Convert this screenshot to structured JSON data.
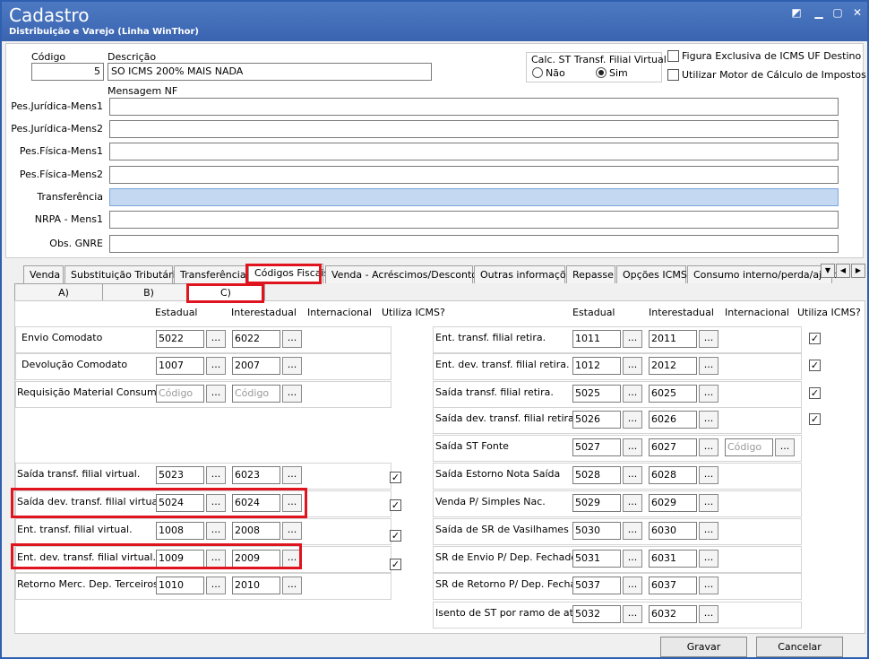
{
  "window": {
    "title": "Cadastro",
    "subtitle": "Distribuição e Varejo (Linha WinThor)"
  },
  "form": {
    "codigo_label": "Código",
    "codigo_value": "5",
    "descricao_label": "Descrição",
    "descricao_value": "SO ICMS 200% MAIS NADA",
    "mensagem_nf_label": "Mensagem NF",
    "calc_st": {
      "title": "Calc. ST Transf. Filial Virtual",
      "opt_nao": "Não",
      "opt_sim": "Sim",
      "selected": "Sim"
    },
    "figura_exclusiva": {
      "label": "Figura Exclusiva de ICMS UF Destino",
      "checked": false
    },
    "utilizar_motor": {
      "label": "Utilizar Motor de Cálculo de Impostos",
      "checked": false
    },
    "message_fields": [
      {
        "label": "Pes.Jurídica-Mens1",
        "value": ""
      },
      {
        "label": "Pes.Jurídica-Mens2",
        "value": ""
      },
      {
        "label": "Pes.Física-Mens1",
        "value": ""
      },
      {
        "label": "Pes.Física-Mens2",
        "value": ""
      },
      {
        "label": "Transferência",
        "value": ""
      },
      {
        "label": "NRPA - Mens1",
        "value": ""
      },
      {
        "label": "Obs. GNRE",
        "value": ""
      }
    ]
  },
  "tabs": [
    "Venda",
    "Substituição Tributária",
    "Transferência",
    "Códigos Fiscais",
    "Venda - Acréscimos/Descontos",
    "Outras informações",
    "Repasse",
    "Opções ICMS",
    "Consumo interno/perda/ajuste"
  ],
  "active_tab": "Códigos Fiscais",
  "subtabs": [
    "A)",
    "B)",
    "C)"
  ],
  "active_subtab": "C)",
  "columns": {
    "estadual": "Estadual",
    "interestadual": "Interestadual",
    "internacional": "Internacional",
    "utiliza_icms": "Utiliza ICMS?"
  },
  "placeholder_codigo": "Código",
  "left_rows": [
    {
      "label": "Envio Comodato",
      "estadual": "5022",
      "interestadual": "6022"
    },
    {
      "label": "Devolução Comodato",
      "estadual": "1007",
      "interestadual": "2007"
    },
    {
      "label": "Requisição Material Consumo",
      "estadual": "",
      "interestadual": ""
    },
    {
      "label": "Saída transf. filial virtual.",
      "estadual": "5023",
      "interestadual": "6023",
      "utiliza": true
    },
    {
      "label": "Saída dev. transf. filial virtual.",
      "estadual": "5024",
      "interestadual": "6024",
      "utiliza": true
    },
    {
      "label": "Ent. transf. filial virtual.",
      "estadual": "1008",
      "interestadual": "2008",
      "utiliza": true
    },
    {
      "label": "Ent. dev. transf. filial virtual.",
      "estadual": "1009",
      "interestadual": "2009",
      "utiliza": true
    },
    {
      "label": "Retorno Merc. Dep. Terceiros",
      "estadual": "1010",
      "interestadual": "2010"
    }
  ],
  "right_rows": [
    {
      "label": "Ent. transf. filial retira.",
      "estadual": "1011",
      "interestadual": "2011",
      "utiliza": true
    },
    {
      "label": "Ent. dev. transf. filial retira.",
      "estadual": "1012",
      "interestadual": "2012",
      "utiliza": true
    },
    {
      "label": "Saída transf. filial retira.",
      "estadual": "5025",
      "interestadual": "6025",
      "utiliza": true
    },
    {
      "label": "Saída dev. transf. filial retira.",
      "estadual": "5026",
      "interestadual": "6026",
      "utiliza": true
    },
    {
      "label": "Saída ST Fonte",
      "estadual": "5027",
      "interestadual": "6027",
      "internacional": ""
    },
    {
      "label": "Saída Estorno Nota Saída",
      "estadual": "5028",
      "interestadual": "6028"
    },
    {
      "label": "Venda P/ Simples Nac.",
      "estadual": "5029",
      "interestadual": "6029"
    },
    {
      "label": "Saída de SR de Vasilhames",
      "estadual": "5030",
      "interestadual": "6030"
    },
    {
      "label": "SR de Envio P/ Dep. Fechado",
      "estadual": "5031",
      "interestadual": "6031"
    },
    {
      "label": "SR de Retorno P/ Dep. Fechado",
      "estadual": "5037",
      "interestadual": "6037"
    },
    {
      "label": "Isento de ST por ramo de ativ.",
      "estadual": "5032",
      "interestadual": "6032"
    }
  ],
  "buttons": {
    "gravar": "Gravar",
    "cancelar": "Cancelar",
    "dots": "...",
    "check": "✓"
  },
  "highlight_color": "#e0141e"
}
